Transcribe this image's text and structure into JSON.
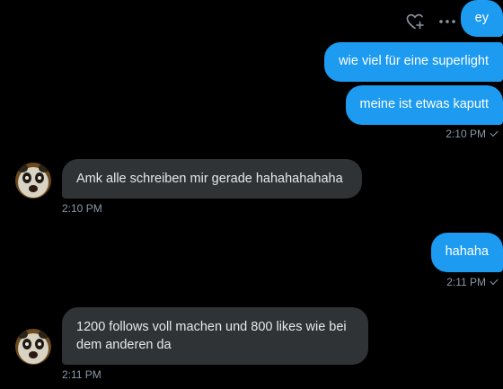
{
  "conversation": {
    "messages": [
      {
        "direction": "outgoing",
        "text": "ey"
      },
      {
        "direction": "outgoing",
        "text": "wie viel für eine superlight"
      },
      {
        "direction": "outgoing",
        "text": "meine ist etwas kaputt",
        "time": "2:10 PM"
      },
      {
        "direction": "incoming",
        "text": "Amk alle schreiben mir gerade hahahahahaha",
        "time": "2:10 PM"
      },
      {
        "direction": "outgoing",
        "text": "hahaha",
        "time": "2:11 PM"
      },
      {
        "direction": "incoming",
        "text": "1200 follows voll machen und 800 likes wie bei dem anderen da",
        "time": "2:11 PM"
      }
    ]
  },
  "message_actions": {
    "icons": [
      "heart-plus-icon",
      "more-icon"
    ]
  },
  "colors": {
    "background": "#000000",
    "outgoing_bubble": "#1d9bf0",
    "incoming_bubble": "#2f3336",
    "timestamp": "#8b98a5",
    "text_light": "#e7e9ea"
  }
}
